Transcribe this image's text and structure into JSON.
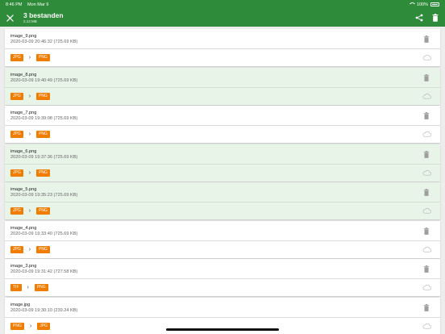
{
  "status_bar": {
    "time": "8:46 PM",
    "date": "Mon Mar 9",
    "battery": "100%"
  },
  "app_bar": {
    "title": "3 bestanden",
    "subtitle": "2.13 MB"
  },
  "colors": {
    "primary": "#2e8b3a",
    "chip": "#f07c00",
    "selected_row": "#e8f4e8"
  },
  "icons": {
    "close": "close-icon",
    "share": "share-icon",
    "delete": "trash-icon",
    "cloud": "cloud-icon",
    "arrow": "chevron-right-icon"
  },
  "files": [
    {
      "name": "image_9.png",
      "meta": "2020-03-09 20:46:32 (725.69 KB)",
      "from": "JPG",
      "to": "PNG",
      "selected": false
    },
    {
      "name": "image_8.png",
      "meta": "2020-03-09 19:40:49 (725.69 KB)",
      "from": "JPG",
      "to": "PNG",
      "selected": true
    },
    {
      "name": "image_7.png",
      "meta": "2020-03-09 19:39:08 (725.69 KB)",
      "from": "JPG",
      "to": "PNG",
      "selected": false
    },
    {
      "name": "image_6.png",
      "meta": "2020-03-09 19:37:36 (725.69 KB)",
      "from": "JPG",
      "to": "PNG",
      "selected": true
    },
    {
      "name": "image_5.png",
      "meta": "2020-03-09 19:35:23 (725.69 KB)",
      "from": "JPG",
      "to": "PNG",
      "selected": true
    },
    {
      "name": "image_4.png",
      "meta": "2020-03-09 19:33:40 (725.69 KB)",
      "from": "JPG",
      "to": "PNG",
      "selected": false
    },
    {
      "name": "image_3.png",
      "meta": "2020-03-09 19:31:42 (727.58 KB)",
      "from": "TIF",
      "to": "PNG",
      "selected": false
    },
    {
      "name": "image.jpg",
      "meta": "2020-03-09 19:30:10 (239.24 KB)",
      "from": "PNG",
      "to": "JPG",
      "selected": false
    }
  ]
}
